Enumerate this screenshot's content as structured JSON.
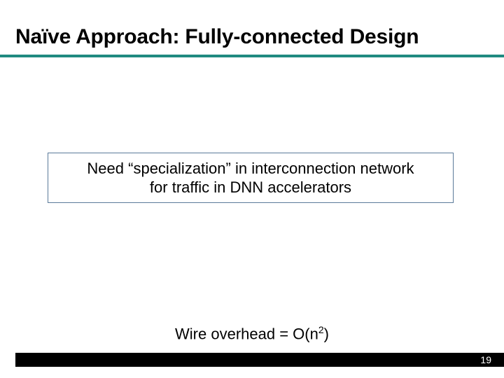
{
  "title": "Naïve Approach: Fully-connected Design",
  "callout": {
    "line1": "Need “specialization” in interconnection network",
    "line2": "for traffic in DNN accelerators"
  },
  "formula": {
    "prefix": "Wire overhead = O(n",
    "exp": "2",
    "suffix": ")"
  },
  "page_number": "19",
  "colors": {
    "accent": "#1f8a80",
    "box_border": "#5a7a9a"
  }
}
